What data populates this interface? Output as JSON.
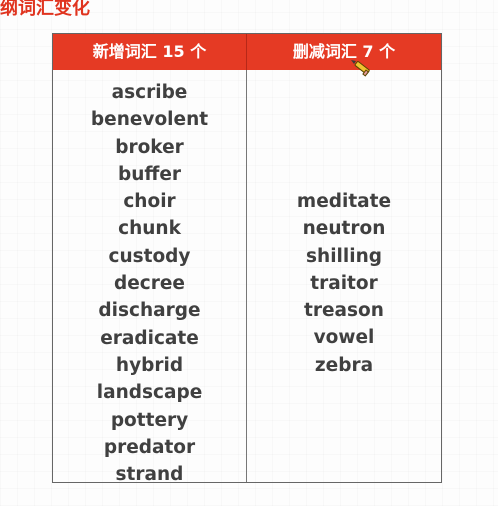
{
  "heading": "纲词汇变化",
  "table": {
    "added_header": "新增词汇 15 个",
    "removed_header": "删减词汇 7 个",
    "added_words": [
      "ascribe",
      "benevolent",
      "broker",
      "buffer",
      "choir",
      "chunk",
      "custody",
      "decree",
      "discharge",
      "eradicate",
      "hybrid",
      "landscape",
      "pottery",
      "predator",
      "strand"
    ],
    "removed_words": [
      "meditate",
      "neutron",
      "shilling",
      "traitor",
      "treason",
      "vowel",
      "zebra"
    ]
  },
  "colors": {
    "header_bg": "#e53a24",
    "heading_text": "#e0341f",
    "word_text": "#404040"
  },
  "icons": {
    "cursor": "pencil-icon"
  }
}
